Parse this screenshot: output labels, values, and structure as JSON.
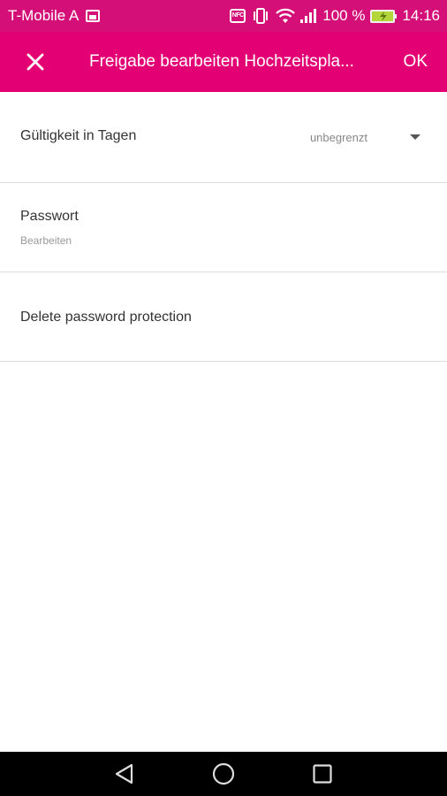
{
  "status_bar": {
    "carrier": "T-Mobile A",
    "nfc_label": "NFC",
    "battery_percent": "100 %",
    "time": "14:16"
  },
  "app_bar": {
    "title": "Freigabe bearbeiten Hochzeitspla...",
    "ok_label": "OK"
  },
  "validity": {
    "label": "Gültigkeit in Tagen",
    "value": "unbegrenzt"
  },
  "password": {
    "label": "Passwort",
    "sub_label": "Bearbeiten"
  },
  "delete_protection": {
    "label": "Delete password protection"
  },
  "colors": {
    "brand_magenta": "#e20074",
    "status_bar": "#d40f78"
  }
}
